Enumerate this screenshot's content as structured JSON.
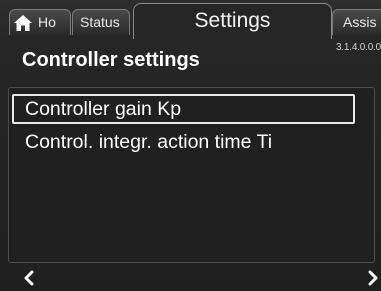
{
  "tabs": {
    "home": {
      "label": "Ho",
      "icon": "home-icon"
    },
    "status": {
      "label": "Status"
    },
    "settings": {
      "label": "Settings"
    },
    "assist": {
      "label": "Assis"
    }
  },
  "version": "3.1.4.0.0.0",
  "page_title": "Controller settings",
  "menu": {
    "items": [
      {
        "label": "Controller gain Kp",
        "selected": true
      },
      {
        "label": "Control. integr. action time Ti",
        "selected": false
      }
    ]
  },
  "nav": {
    "back_icon": "chevron-left-icon",
    "forward_icon": "chevron-right-icon"
  },
  "colors": {
    "background": "#262626",
    "text": "#ffffff",
    "selection_border": "#eaeaea"
  }
}
